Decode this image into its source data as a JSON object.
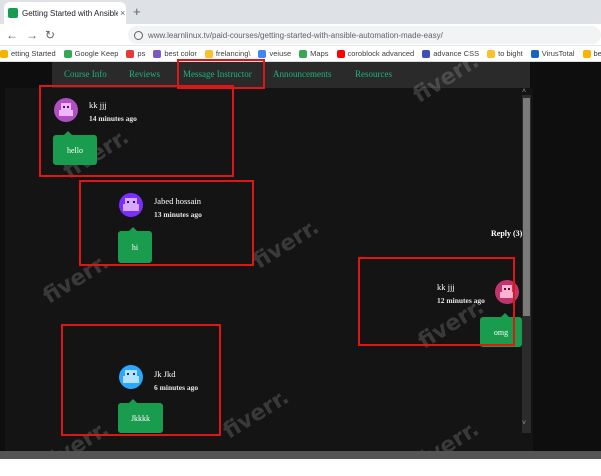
{
  "browser": {
    "tab_title": "Getting Started with Ansible: A",
    "tab_close": "×",
    "new_tab": "+",
    "url": "www.learnlinux.tv/paid-courses/getting-started-with-ansible-automation-made-easy/",
    "bookmarks": [
      "etting Started",
      "Google Keep",
      "ps",
      "best color",
      "frelancing\\",
      "veiuse",
      "Maps",
      "coroblock advanced",
      "advance CSS",
      "to bight",
      "VirusTotal",
      "best-remove.bg"
    ],
    "bookmark_colors": [
      "#f4b400",
      "#34a853",
      "#e53935",
      "#7e57c2",
      "#fbc02d",
      "#4285f4",
      "#34a853",
      "#ff0000",
      "#3f51b5",
      "#fbc02d",
      "#1565c0",
      "#ffb300"
    ]
  },
  "course_nav": {
    "items": [
      "Course Info",
      "Reviews",
      "Message Instructor",
      "Announcements",
      "Resources"
    ]
  },
  "messages": [
    {
      "name": "kk jjj",
      "time": "14 minutes ago",
      "text": "hello",
      "avatar_color": "#b04fc4"
    },
    {
      "name": "Jabed hossain",
      "time": "13 minutes ago",
      "text": "hi",
      "avatar_color": "#7b2cff"
    },
    {
      "name": "kk jjj",
      "time": "12 minutes ago",
      "text": "omg",
      "avatar_color": "#c0346e"
    },
    {
      "name": "Jk Jkd",
      "time": "6 minutes ago",
      "text": "Jkkkk",
      "avatar_color": "#2aa7ff"
    }
  ],
  "reply_label": "Reply (3)",
  "watermark": "fiverr.",
  "scroll": {
    "up": "˄",
    "down": "˅"
  },
  "colors": {
    "accent": "#20b37a",
    "bubble": "#1a9c4e",
    "annotation": "#e01515",
    "background": "#0e0e0e"
  }
}
